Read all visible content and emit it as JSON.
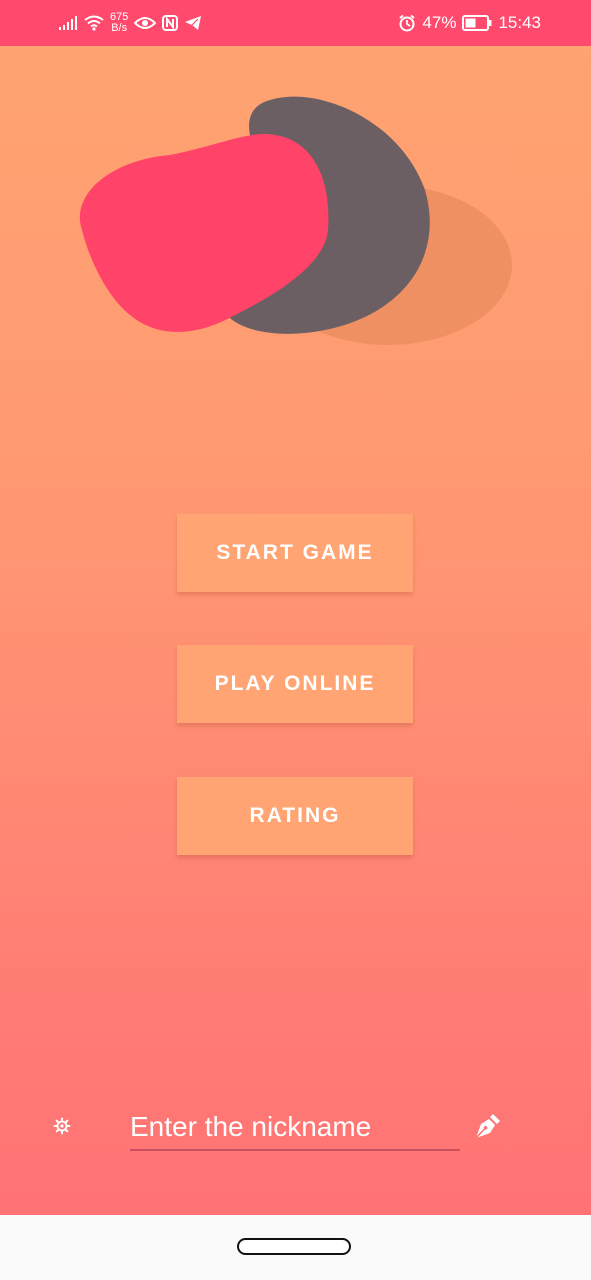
{
  "status_bar": {
    "net_speed_value": "675",
    "net_speed_unit": "B/s",
    "battery_percent": "47%",
    "time": "15:43",
    "icons": [
      "signal-icon",
      "wifi-icon",
      "eye-icon",
      "nfc-icon",
      "telegram-icon",
      "alarm-icon",
      "battery-icon"
    ]
  },
  "menu": {
    "start_game_label": "START GAME",
    "play_online_label": "PLAY ONLINE",
    "rating_label": "RATING"
  },
  "nickname": {
    "placeholder": "Enter the nickname",
    "value": ""
  },
  "icons": {
    "settings": "gear-icon",
    "edit": "pen-nib-icon",
    "logo": "blob-logo"
  },
  "colors": {
    "status_bar": "#FF4A6E",
    "gradient_top": "#FFA471",
    "gradient_bottom": "#FF6F76",
    "button": "#FFA472",
    "logo_pink": "#FF4369",
    "logo_gray": "#6B5F64",
    "logo_shadow": "#EF9063"
  }
}
